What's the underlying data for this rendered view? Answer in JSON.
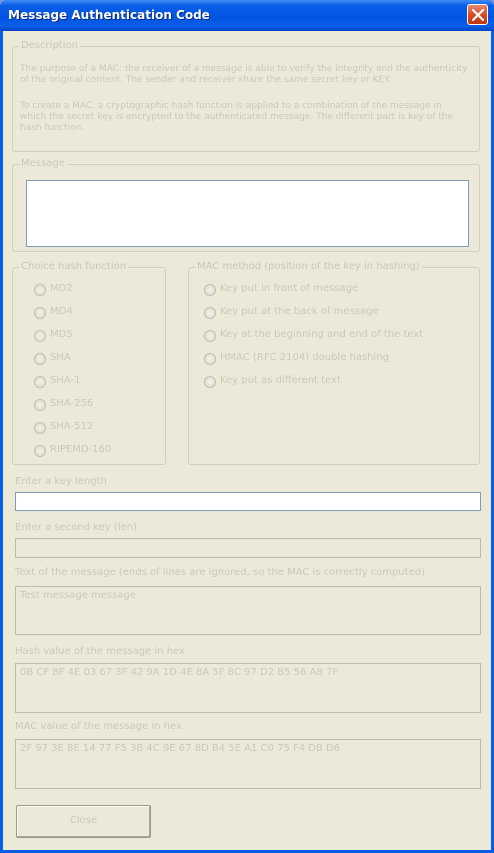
{
  "window": {
    "title": "Message Authentication Code"
  },
  "description": {
    "legend": "Description",
    "paragraph1": "The purpose of a MAC: the receiver of a message is able to verify the integrity and the authenticity of the original content. The sender and receiver share the same secret key or KEY.",
    "paragraph2": "To create a MAC, a cryptographic hash function is applied to a combination of the message in which the secret key is encrypted to the authenticated message. The different part is key of the hash function."
  },
  "message": {
    "legend": "Message",
    "value": ""
  },
  "hash_function": {
    "legend": "Choice hash function",
    "options": [
      "MD2",
      "MD4",
      "MD5",
      "SHA",
      "SHA-1",
      "SHA-256",
      "SHA-512",
      "RIPEMD-160"
    ]
  },
  "mac_method": {
    "legend": "MAC method (position of the key in hashing)",
    "options": [
      "Key put in front of message",
      "Key put at the back of message",
      "Key at the beginning and end of the text",
      "HMAC (RFC 2104) double hashing",
      "Key put as different text"
    ]
  },
  "first_key": {
    "label": "Enter a key length",
    "value": ""
  },
  "second_key": {
    "label": "Enter a second key (len)",
    "value": ""
  },
  "message_text": {
    "label": "Text of the message (ends of lines are ignored, so the MAC is correctly computed)",
    "value": "Test message message"
  },
  "hash_value": {
    "label": "Hash value of the message in hex",
    "value": "0B CF 8F 4E 03 67 3F 42 9A 1D 4E 8A 5F 8C 97 D2 B5 56 A8 7F"
  },
  "mac_value": {
    "label": "MAC value of the message in hex",
    "value": "2F 97 3E 8E 14 77 F5 3B 4C 9E 67 8D B4 5E A1 C0 75 F4 DB D6"
  },
  "buttons": {
    "close": "Close"
  }
}
